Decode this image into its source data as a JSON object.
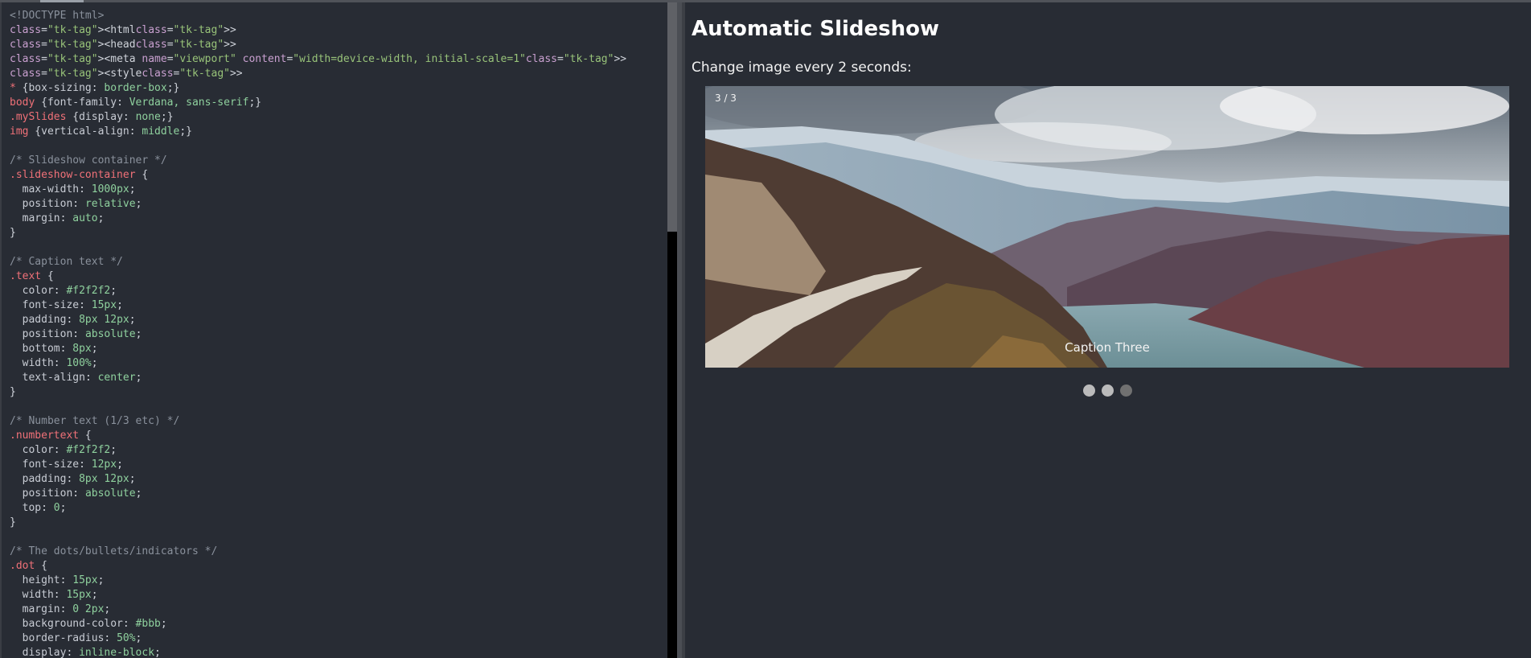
{
  "code": [
    "<!DOCTYPE html>",
    "<html>",
    "<head>",
    "<meta name=\"viewport\" content=\"width=device-width, initial-scale=1\">",
    "<style>",
    "* {box-sizing: border-box;}",
    "body {font-family: Verdana, sans-serif;}",
    ".mySlides {display: none;}",
    "img {vertical-align: middle;}",
    "",
    "/* Slideshow container */",
    ".slideshow-container {",
    "  max-width: 1000px;",
    "  position: relative;",
    "  margin: auto;",
    "}",
    "",
    "/* Caption text */",
    ".text {",
    "  color: #f2f2f2;",
    "  font-size: 15px;",
    "  padding: 8px 12px;",
    "  position: absolute;",
    "  bottom: 8px;",
    "  width: 100%;",
    "  text-align: center;",
    "}",
    "",
    "/* Number text (1/3 etc) */",
    ".numbertext {",
    "  color: #f2f2f2;",
    "  font-size: 12px;",
    "  padding: 8px 12px;",
    "  position: absolute;",
    "  top: 0;",
    "}",
    "",
    "/* The dots/bullets/indicators */",
    ".dot {",
    "  height: 15px;",
    "  width: 15px;",
    "  margin: 0 2px;",
    "  background-color: #bbb;",
    "  border-radius: 50%;",
    "  display: inline-block;"
  ],
  "preview": {
    "title": "Automatic Slideshow",
    "intro": "Change image every 2 seconds:",
    "slideshow": {
      "number_text": "3 / 3",
      "caption": "Caption Three",
      "image": "mountain-lake-landscape",
      "dots": [
        {
          "active": false
        },
        {
          "active": false
        },
        {
          "active": true
        }
      ]
    }
  },
  "scrollbar": {
    "position": 0.35
  }
}
